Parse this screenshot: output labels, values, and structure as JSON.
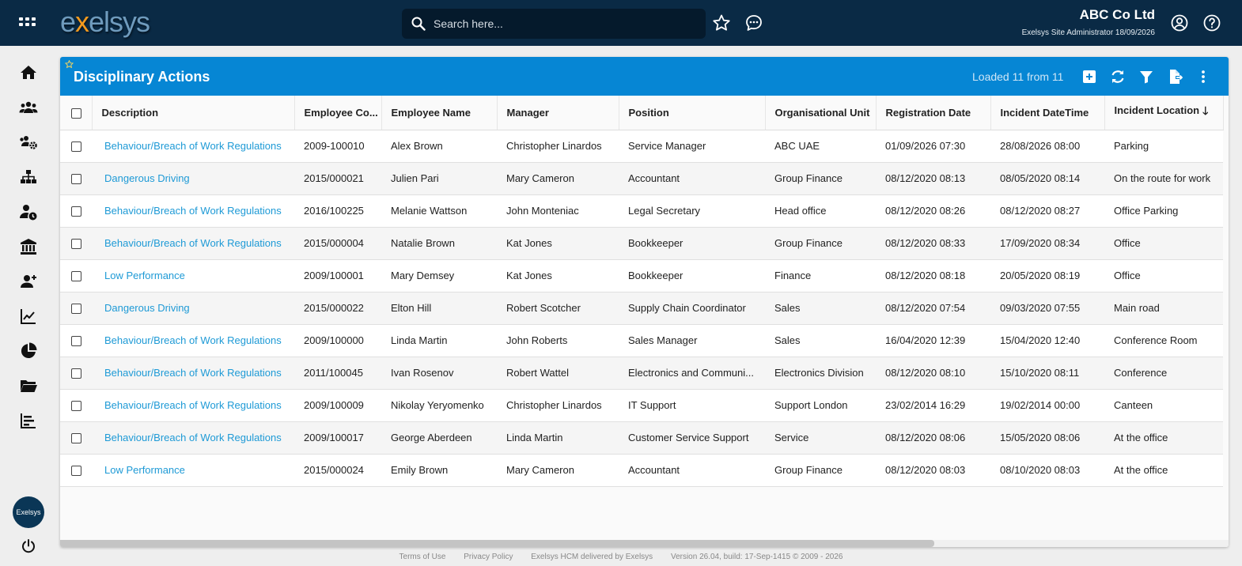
{
  "app": {
    "logo_pre": "e",
    "logo_x": "x",
    "logo_post": "elsys",
    "search_placeholder": "Search here...",
    "company_name": "ABC Co Ltd",
    "user_line": "Exelsys Site Administrator 18/09/2026",
    "avatar_label": "Exelsys"
  },
  "sidebar_icons": [
    "home-icon",
    "people-icon",
    "team-settings-icon",
    "org-chart-icon",
    "person-clock-icon",
    "bank-icon",
    "add-person-icon",
    "line-chart-icon",
    "pie-chart-icon",
    "folder-icon",
    "bar-list-icon"
  ],
  "panel": {
    "title": "Disciplinary Actions",
    "loaded": "Loaded 11 from 11"
  },
  "columns": [
    "Description",
    "Employee Co...",
    "Employee Name",
    "Manager",
    "Position",
    "Organisational Unit",
    "Registration Date",
    "Incident DateTime",
    "Incident Location"
  ],
  "sort_indicator": "🡓",
  "rows": [
    {
      "description": "Behaviour/Breach of Work Regulations",
      "code": "2009-100010",
      "name": "Alex Brown",
      "manager": "Christopher Linardos",
      "position": "Service Manager",
      "unit": "ABC UAE",
      "reg_date": "01/09/2026 07:30",
      "incident": "28/08/2026 08:00",
      "location": "Parking"
    },
    {
      "description": "Dangerous Driving",
      "code": "2015/000021",
      "name": "Julien Pari",
      "manager": "Mary Cameron",
      "position": "Accountant",
      "unit": "Group Finance",
      "reg_date": "08/12/2020 08:13",
      "incident": "08/05/2020 08:14",
      "location": "On the route for work"
    },
    {
      "description": "Behaviour/Breach of Work Regulations",
      "code": "2016/100225",
      "name": "Melanie Wattson",
      "manager": "John Monteniac",
      "position": "Legal Secretary",
      "unit": "Head office",
      "reg_date": "08/12/2020 08:26",
      "incident": "08/12/2020 08:27",
      "location": "Office Parking"
    },
    {
      "description": "Behaviour/Breach of Work Regulations",
      "code": "2015/000004",
      "name": "Natalie Brown",
      "manager": "Kat Jones",
      "position": "Bookkeeper",
      "unit": "Group Finance",
      "reg_date": "08/12/2020 08:33",
      "incident": "17/09/2020 08:34",
      "location": "Office"
    },
    {
      "description": "Low Performance",
      "code": "2009/100001",
      "name": "Mary Demsey",
      "manager": "Kat Jones",
      "position": "Bookkeeper",
      "unit": "Finance",
      "reg_date": "08/12/2020 08:18",
      "incident": "20/05/2020 08:19",
      "location": "Office"
    },
    {
      "description": "Dangerous Driving",
      "code": "2015/000022",
      "name": "Elton Hill",
      "manager": "Robert Scotcher",
      "position": "Supply Chain Coordinator",
      "unit": "Sales",
      "reg_date": "08/12/2020 07:54",
      "incident": "09/03/2020 07:55",
      "location": "Main road"
    },
    {
      "description": "Behaviour/Breach of Work Regulations",
      "code": "2009/100000",
      "name": "Linda Martin",
      "manager": "John Roberts",
      "position": "Sales Manager",
      "unit": "Sales",
      "reg_date": "16/04/2020 12:39",
      "incident": "15/04/2020 12:40",
      "location": "Conference Room"
    },
    {
      "description": "Behaviour/Breach of Work Regulations",
      "code": "2011/100045",
      "name": "Ivan Rosenov",
      "manager": "Robert Wattel",
      "position": "Electronics and Communi...",
      "unit": "Electronics Division",
      "reg_date": "08/12/2020 08:10",
      "incident": "15/10/2020 08:11",
      "location": "Conference"
    },
    {
      "description": "Behaviour/Breach of Work Regulations",
      "code": "2009/100009",
      "name": "Nikolay Yeryomenko",
      "manager": "Christopher Linardos",
      "position": "IT Support",
      "unit": "Support London",
      "reg_date": "23/02/2014 16:29",
      "incident": "19/02/2014 00:00",
      "location": "Canteen"
    },
    {
      "description": "Behaviour/Breach of Work Regulations",
      "code": "2009/100017",
      "name": "George Aberdeen",
      "manager": "Linda Martin",
      "position": "Customer Service Support",
      "unit": "Service",
      "reg_date": "08/12/2020 08:06",
      "incident": "15/05/2020 08:06",
      "location": "At the office"
    },
    {
      "description": "Low Performance",
      "code": "2015/000024",
      "name": "Emily Brown",
      "manager": "Mary Cameron",
      "position": "Accountant",
      "unit": "Group Finance",
      "reg_date": "08/12/2020 08:03",
      "incident": "08/10/2020 08:03",
      "location": "At the office"
    }
  ],
  "footer": {
    "terms": "Terms of Use",
    "privacy": "Privacy Policy",
    "delivered": "Exelsys HCM delivered by Exelsys",
    "version": "Version 26.04, build: 17-Sep-1415 © 2009 - 2026"
  },
  "colors": {
    "topbar": "#0a2a45",
    "panel_header": "#0686d4",
    "link": "#1e9ad6",
    "logo_accent": "#f39a1e"
  }
}
